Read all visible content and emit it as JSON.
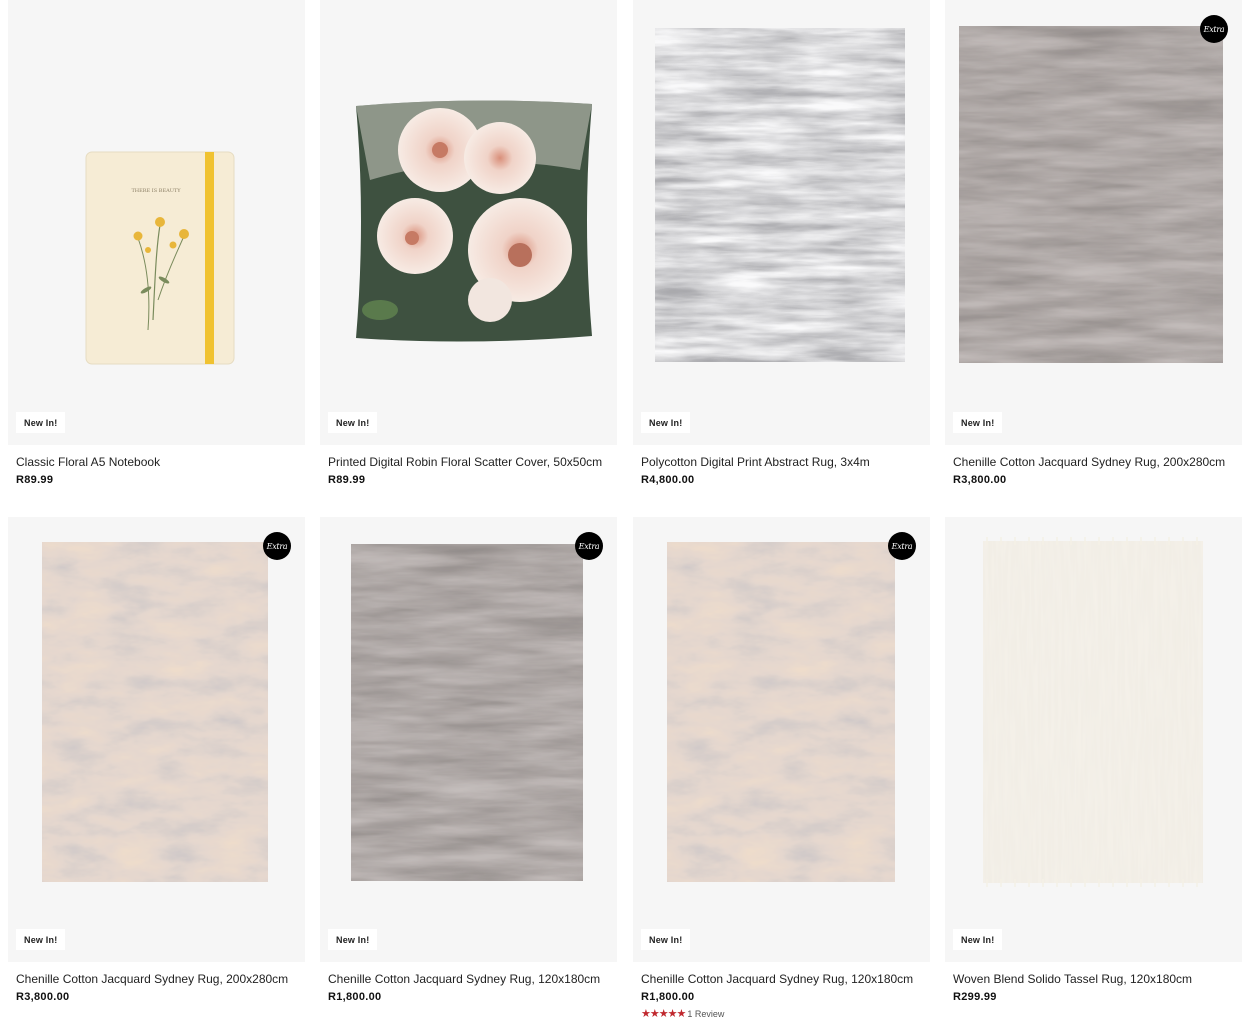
{
  "products": [
    {
      "title": "Classic Floral A5 Notebook",
      "price": "R89.99",
      "badge": "New In!",
      "extra": "",
      "image_icon": "notebook-image"
    },
    {
      "title": "Printed Digital Robin Floral Scatter Cover, 50x50cm",
      "price": "R89.99",
      "badge": "New In!",
      "extra": "",
      "image_icon": "floral-cushion-image"
    },
    {
      "title": "Polycotton Digital Print Abstract Rug, 3x4m",
      "price": "R4,800.00",
      "badge": "New In!",
      "extra": "",
      "image_icon": "grey-abstract-rug-image"
    },
    {
      "title": "Chenille Cotton Jacquard Sydney Rug, 200x280cm",
      "price": "R3,800.00",
      "badge": "New In!",
      "extra": "Extra",
      "image_icon": "dark-rug-image"
    },
    {
      "title": "Chenille Cotton Jacquard Sydney Rug, 200x280cm",
      "price": "R3,800.00",
      "badge": "New In!",
      "extra": "Extra",
      "image_icon": "blush-rug-image"
    },
    {
      "title": "Chenille Cotton Jacquard Sydney Rug, 120x180cm",
      "price": "R1,800.00",
      "badge": "New In!",
      "extra": "Extra",
      "image_icon": "dark-rug-image"
    },
    {
      "title": "Chenille Cotton Jacquard Sydney Rug, 120x180cm",
      "price": "R1,800.00",
      "badge": "New In!",
      "extra": "Extra",
      "image_icon": "blush-rug-image",
      "rating": 5,
      "reviews": "1 Review"
    },
    {
      "title": "Woven Blend Solido Tassel Rug, 120x180cm",
      "price": "R299.99",
      "badge": "New In!",
      "extra": "",
      "image_icon": "cream-tassel-rug-image"
    }
  ],
  "colors": {
    "rating_star": "#c0282e",
    "card_bg": "#f6f6f6",
    "badge_extra_bg": "#000000"
  }
}
